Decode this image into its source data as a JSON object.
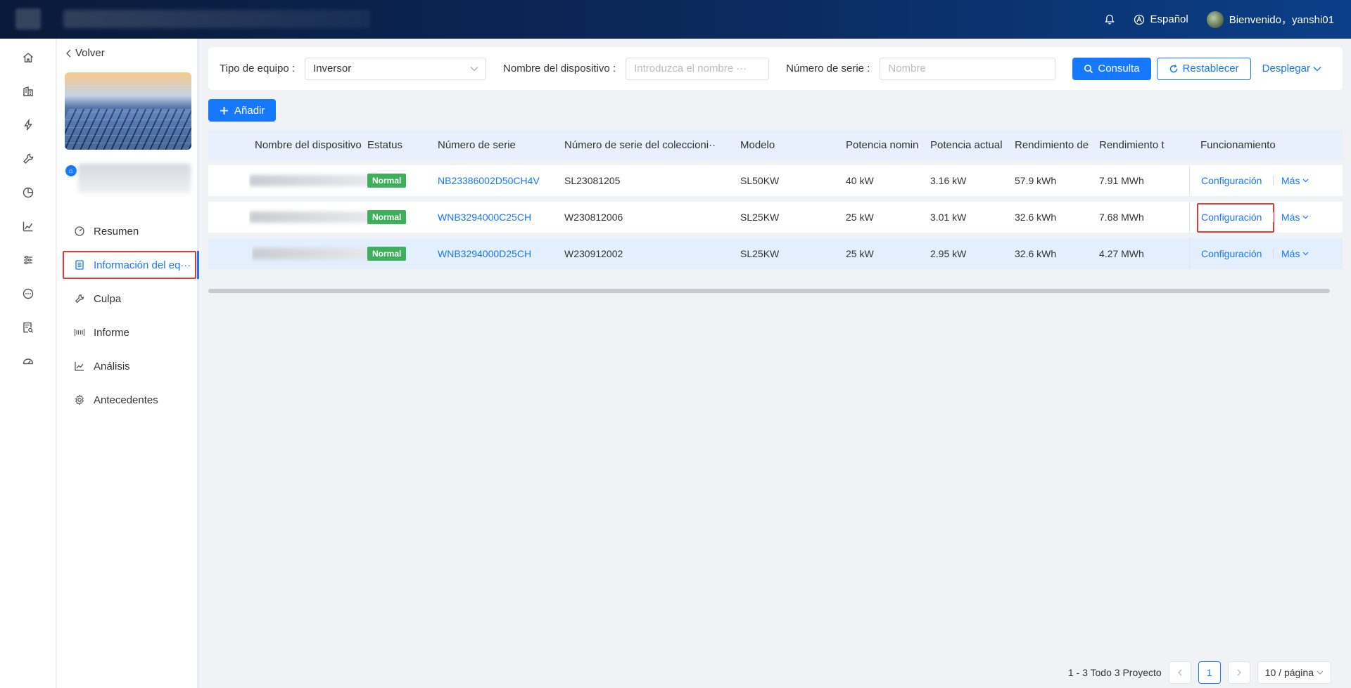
{
  "topbar": {
    "language": "Español",
    "welcome": "Bienvenido，yanshi01"
  },
  "sidebar": {
    "back_label": "Volver",
    "menu": [
      {
        "label": "Resumen",
        "icon": "dashboard-icon"
      },
      {
        "label": "Información del eq···",
        "icon": "document-icon",
        "active": true
      },
      {
        "label": "Culpa",
        "icon": "wrench-icon"
      },
      {
        "label": "Informe",
        "icon": "report-icon"
      },
      {
        "label": "Análisis",
        "icon": "line-chart-icon"
      },
      {
        "label": "Antecedentes",
        "icon": "gear-icon"
      }
    ]
  },
  "filters": {
    "equipment_type_label": "Tipo de equipo",
    "equipment_type_value": "Inversor",
    "device_name_label": "Nombre del dispositivo",
    "device_name_placeholder": "Introduzca el nombre ···",
    "serial_label": "Número de serie",
    "serial_placeholder": "Nombre",
    "query_label": "Consulta",
    "reset_label": "Restablecer",
    "expand_label": "Desplegar"
  },
  "add_label": "Añadir",
  "table": {
    "headers": {
      "name": "Nombre del dispositivo",
      "status": "Estatus",
      "serial": "Número de serie",
      "collector_serial": "Número de serie del coleccioni···",
      "model": "Modelo",
      "rated_power": "Potencia nomin",
      "current_power": "Potencia actual",
      "yield_day": "Rendimiento de",
      "yield_total": "Rendimiento t",
      "operation": "Funcionamiento"
    },
    "rows": [
      {
        "status": "Normal",
        "serial": "NB23386002D50CH4V",
        "collector_serial": "SL23081205",
        "model": "SL50KW",
        "rated_power": "40 kW",
        "current_power": "3.16 kW",
        "yield_day": "57.9 kWh",
        "yield_total": "7.91 MWh",
        "config": "Configuración",
        "more": "Más"
      },
      {
        "status": "Normal",
        "serial": "WNB3294000C25CH",
        "collector_serial": "W230812006",
        "model": "SL25KW",
        "rated_power": "25 kW",
        "current_power": "3.01 kW",
        "yield_day": "32.6 kWh",
        "yield_total": "7.68 MWh",
        "config": "Configuración",
        "more": "Más"
      },
      {
        "status": "Normal",
        "serial": "WNB3294000D25CH",
        "collector_serial": "W230912002",
        "model": "SL25KW",
        "rated_power": "25 kW",
        "current_power": "2.95 kW",
        "yield_day": "32.6 kWh",
        "yield_total": "4.27 MWh",
        "config": "Configuración",
        "more": "Más"
      }
    ]
  },
  "pagination": {
    "summary": "1 - 3 Todo 3 Proyecto",
    "current_page": "1",
    "page_size": "10 / página"
  },
  "colors": {
    "primary": "#1677ff",
    "status_normal": "#3cb05a",
    "highlight": "#e53935"
  }
}
